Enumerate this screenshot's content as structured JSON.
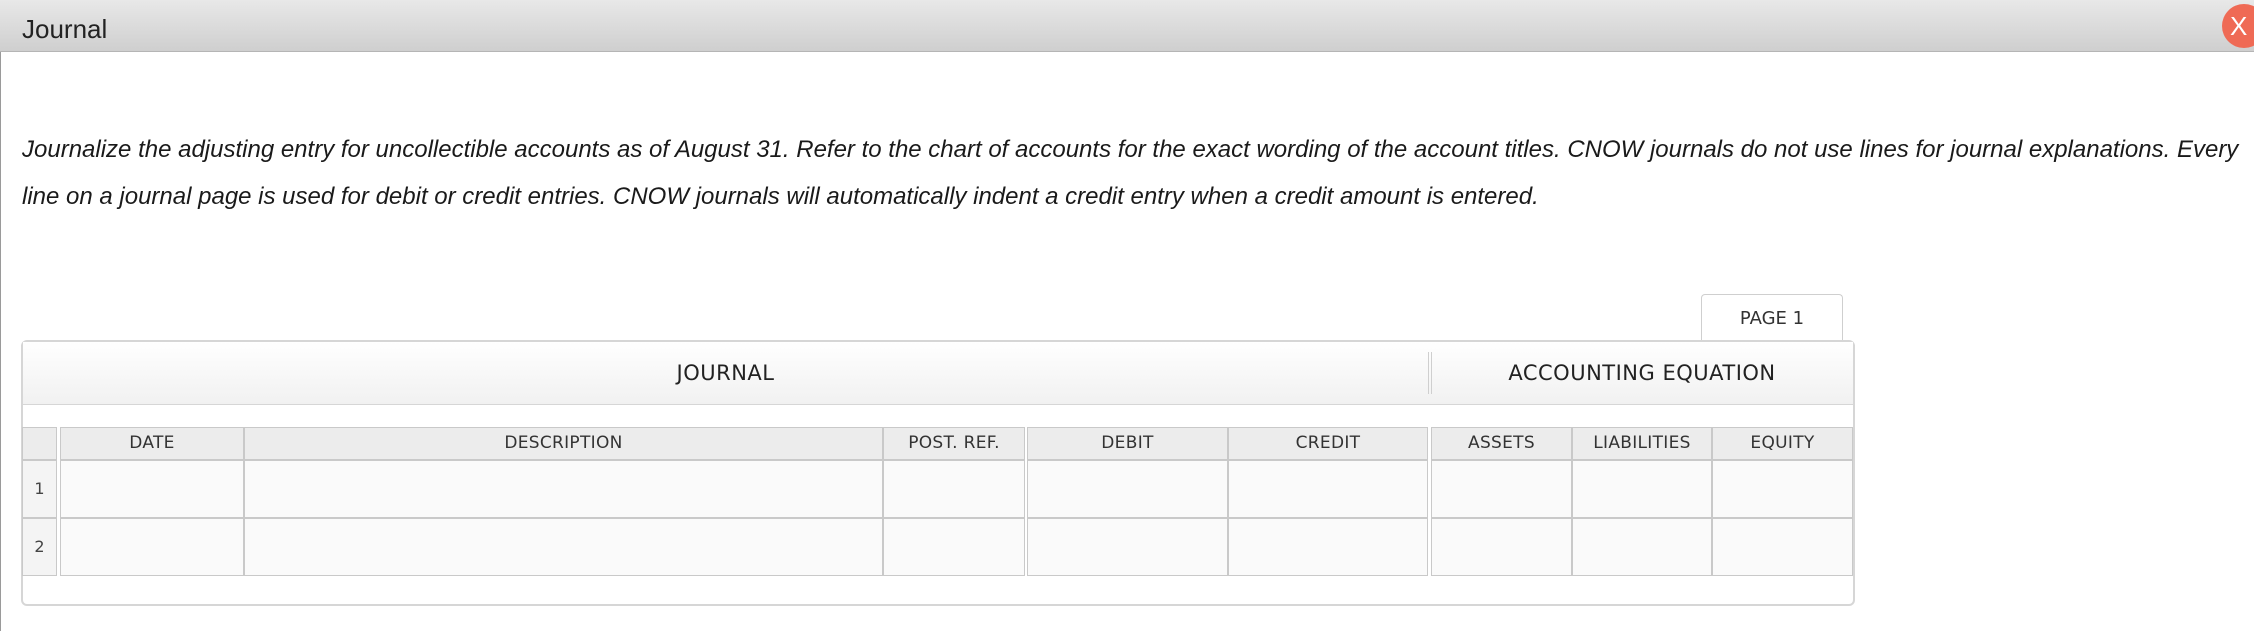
{
  "window": {
    "title": "Journal",
    "close_label": "X"
  },
  "instructions": "Journalize the adjusting entry for uncollectible accounts as of August 31. Refer to the chart of accounts for the exact wording of the account titles. CNOW journals do not use lines for journal explanations. Every line on a journal page is used for debit or credit entries. CNOW journals will automatically indent a credit entry when a credit amount is entered.",
  "page_tab": "PAGE 1",
  "table": {
    "journal_header": "JOURNAL",
    "equation_header": "ACCOUNTING EQUATION",
    "columns": {
      "date": "DATE",
      "description": "DESCRIPTION",
      "post_ref": "POST. REF.",
      "debit": "DEBIT",
      "credit": "CREDIT",
      "assets": "ASSETS",
      "liabilities": "LIABILITIES",
      "equity": "EQUITY"
    },
    "rows": [
      {
        "number": "1",
        "date": "",
        "description": "",
        "post_ref": "",
        "debit": "",
        "credit": "",
        "assets": "",
        "liabilities": "",
        "equity": ""
      },
      {
        "number": "2",
        "date": "",
        "description": "",
        "post_ref": "",
        "debit": "",
        "credit": "",
        "assets": "",
        "liabilities": "",
        "equity": ""
      }
    ]
  },
  "colors": {
    "close_button": "#ef6a55",
    "header_bg": "#ececec",
    "border": "#c9c9c9"
  }
}
